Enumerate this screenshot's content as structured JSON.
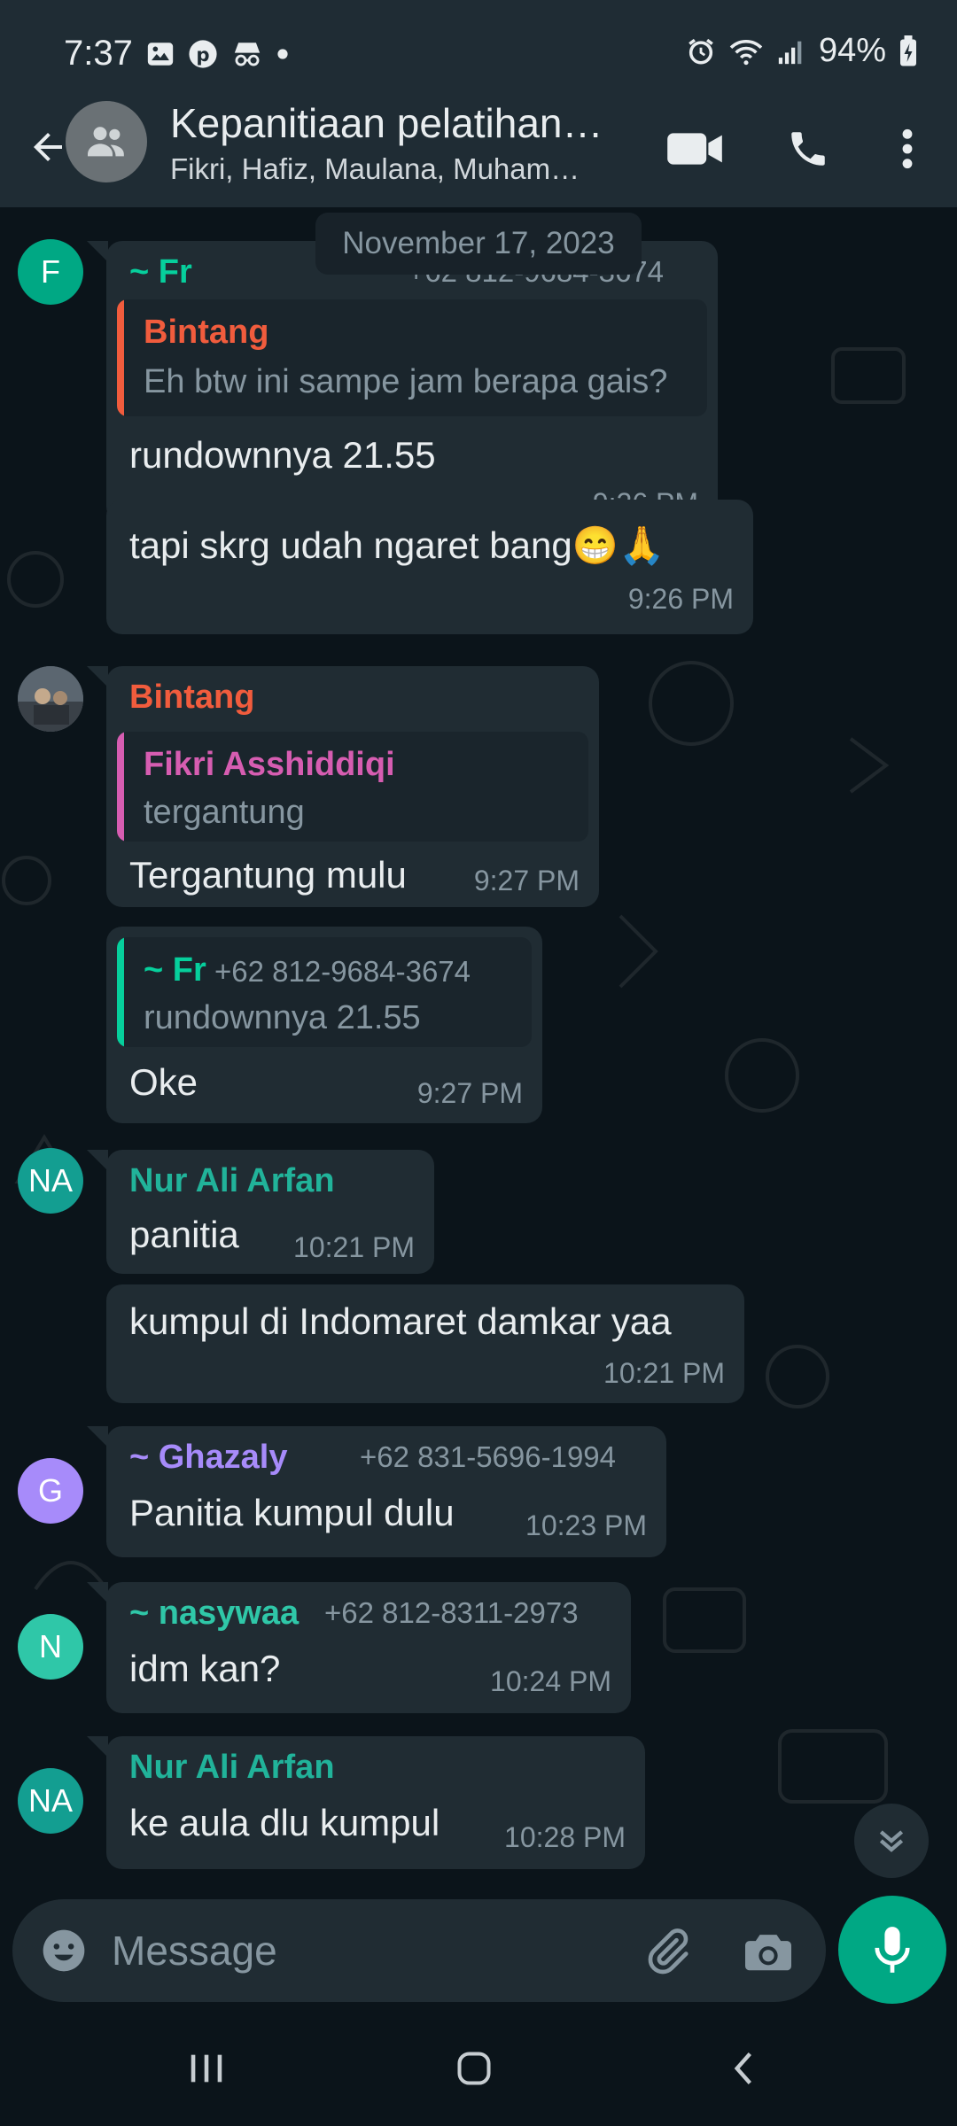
{
  "status_bar": {
    "time": "7:37",
    "battery": "94%"
  },
  "header": {
    "title": "Kepanitiaan pelatihan…",
    "subtitle": "Fikri, Hafiz, Maulana, Muham…"
  },
  "date_chip": "November 17, 2023",
  "messages": [
    {
      "sender": "~ Fr",
      "phone": "+62 812-9684-3674",
      "quote_name": "Bintang",
      "quote_text": "Eh btw ini sampe jam berapa gais?",
      "text": "rundownnya 21.55",
      "time": "9:26 PM",
      "avatar": "F"
    },
    {
      "text": "tapi skrg udah ngaret bang😁🙏",
      "time": "9:26 PM"
    },
    {
      "sender": "Bintang",
      "quote_name": "Fikri Asshiddiqi",
      "quote_text": "tergantung",
      "text": "Tergantung mulu",
      "time": "9:27 PM"
    },
    {
      "quote_name": "~ Fr",
      "quote_phone": "+62 812-9684-3674",
      "quote_text": "rundownnya 21.55",
      "text": "Oke",
      "time": "9:27 PM"
    },
    {
      "sender": "Nur Ali Arfan",
      "text": "panitia",
      "time": "10:21 PM",
      "avatar": "NA"
    },
    {
      "text": "kumpul di Indomaret damkar yaa",
      "time": "10:21 PM"
    },
    {
      "sender": "~ Ghazaly",
      "phone": "+62 831-5696-1994",
      "text": "Panitia kumpul dulu",
      "time": "10:23 PM",
      "avatar": "G"
    },
    {
      "sender": "~ nasywaa",
      "phone": "+62 812-8311-2973",
      "text": "idm kan?",
      "time": "10:24 PM",
      "avatar": "N"
    },
    {
      "sender": "Nur Ali Arfan",
      "text": "ke aula dlu kumpul",
      "time": "10:28 PM",
      "avatar": "NA"
    }
  ],
  "composer": {
    "placeholder": "Message"
  },
  "colors": {
    "accent": "#00a884",
    "fr": "#06cf9c",
    "bintang": "#f15c3d",
    "fikri": "#d65db1",
    "nur": "#21b39a",
    "ghazaly": "#a78bfa",
    "nasywaa": "#2fc7a8"
  }
}
